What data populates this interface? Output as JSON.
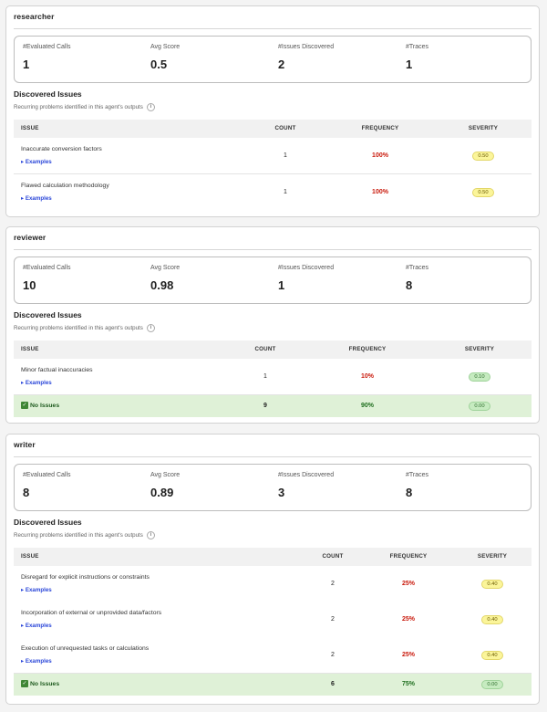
{
  "labels": {
    "evaluated_calls": "#Evaluated Calls",
    "avg_score": "Avg Score",
    "issues_discovered": "#Issues Discovered",
    "traces": "#Traces",
    "discovered_issues": "Discovered Issues",
    "subtitle": "Recurring problems identified in this agent's outputs",
    "col_issue": "ISSUE",
    "col_count": "COUNT",
    "col_frequency": "FREQUENCY",
    "col_severity": "SEVERITY",
    "examples": "▸ Examples",
    "no_issues": "No Issues",
    "info_glyph": "i",
    "check_glyph": "✓"
  },
  "agents": [
    {
      "name": "researcher",
      "stats": {
        "evaluated_calls": "1",
        "avg_score": "0.5",
        "issues_discovered": "2",
        "traces": "1"
      },
      "issues": [
        {
          "name": "Inaccurate conversion factors",
          "count": "1",
          "frequency": "100%",
          "severity": "0.50",
          "severity_level": "yellow"
        },
        {
          "name": "Flawed calculation methodology",
          "count": "1",
          "frequency": "100%",
          "severity": "0.50",
          "severity_level": "yellow"
        }
      ]
    },
    {
      "name": "reviewer",
      "stats": {
        "evaluated_calls": "10",
        "avg_score": "0.98",
        "issues_discovered": "1",
        "traces": "8"
      },
      "issues": [
        {
          "name": "Minor factual inaccuracies",
          "count": "1",
          "frequency": "10%",
          "severity": "0.10",
          "severity_level": "green"
        }
      ],
      "no_issues": {
        "count": "9",
        "frequency": "90%",
        "severity": "0.00"
      }
    },
    {
      "name": "writer",
      "stats": {
        "evaluated_calls": "8",
        "avg_score": "0.89",
        "issues_discovered": "3",
        "traces": "8"
      },
      "issues": [
        {
          "name": "Disregard for explicit instructions or constraints",
          "count": "2",
          "frequency": "25%",
          "severity": "0.40",
          "severity_level": "yellow"
        },
        {
          "name": "Incorporation of external or unprovided data/factors",
          "count": "2",
          "frequency": "25%",
          "severity": "0.40",
          "severity_level": "yellow"
        },
        {
          "name": "Execution of unrequested tasks or calculations",
          "count": "2",
          "frequency": "25%",
          "severity": "0.40",
          "severity_level": "yellow"
        }
      ],
      "no_issues": {
        "count": "6",
        "frequency": "75%",
        "severity": "0.00"
      }
    }
  ],
  "colors": {
    "accent_link": "#2b47d9",
    "frequency_red": "#c9190b",
    "ok_row_bg": "#dff1d7",
    "severity_yellow": "#fbf59a",
    "severity_green": "#c6ebc0"
  }
}
